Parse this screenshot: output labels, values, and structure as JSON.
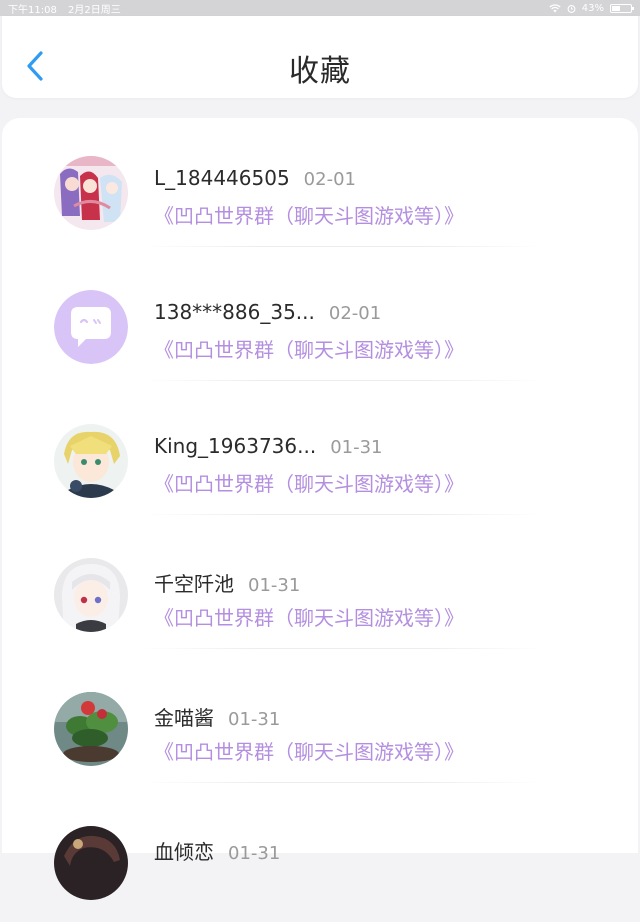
{
  "status_bar": {
    "time": "下午11:08",
    "date": "2月2日周三",
    "battery": "43%",
    "battery_level": 0.43
  },
  "header": {
    "title": "收藏",
    "back_icon": "chevron-left-icon",
    "accent_color": "#2f9bf3"
  },
  "favorites": [
    {
      "name": "L_184446505",
      "time": "02-01",
      "group": "《凹凸世界群（聊天斗图游戏等）》",
      "avatar": "anime-girls-avatar"
    },
    {
      "name": "138***886_35...",
      "time": "02-01",
      "group": "《凹凸世界群（聊天斗图游戏等）》",
      "avatar": "default-chat-avatar"
    },
    {
      "name": "King_1963736...",
      "time": "01-31",
      "group": "《凹凸世界群（聊天斗图游戏等）》",
      "avatar": "blonde-boy-avatar"
    },
    {
      "name": "千空阡池",
      "time": "01-31",
      "group": "《凹凸世界群（聊天斗图游戏等）》",
      "avatar": "white-hair-girl-avatar"
    },
    {
      "name": "金喵酱",
      "time": "01-31",
      "group": "《凹凸世界群（聊天斗图游戏等）》",
      "avatar": "flower-plant-avatar"
    },
    {
      "name": "血倾恋",
      "time": "01-31",
      "group": "",
      "avatar": "dark-avatar"
    }
  ],
  "colors": {
    "group_text": "#b48fe0",
    "default_avatar_bg": "#d9c4f7"
  }
}
